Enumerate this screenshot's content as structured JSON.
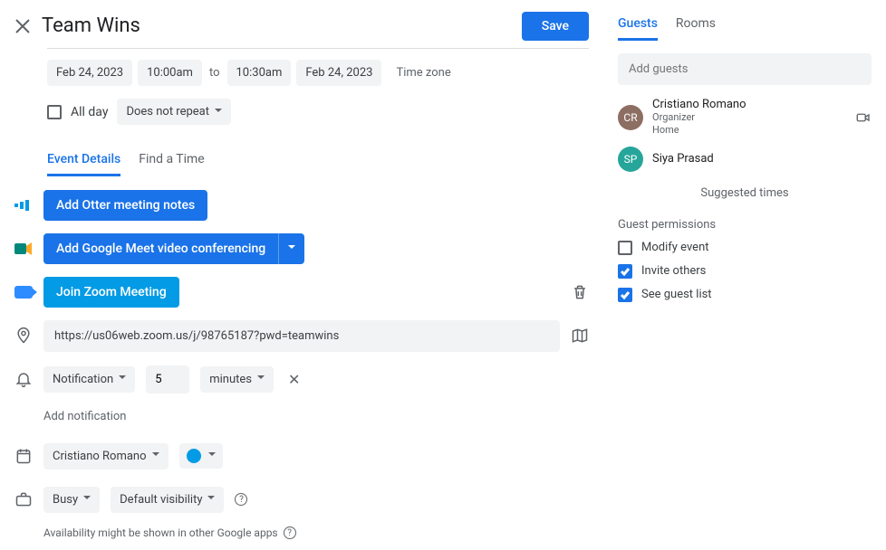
{
  "header": {
    "title": "Team Wins",
    "save_label": "Save"
  },
  "dates": {
    "start_date": "Feb 24, 2023",
    "start_time": "10:00am",
    "to_label": "to",
    "end_time": "10:30am",
    "end_date": "Feb 24, 2023",
    "timezone_label": "Time zone"
  },
  "allday": {
    "label": "All day",
    "checked": false,
    "repeat": "Does not repeat"
  },
  "tabs": {
    "details": "Event Details",
    "find_time": "Find a Time"
  },
  "buttons": {
    "otter": "Add Otter meeting notes",
    "meet": "Add Google Meet video conferencing",
    "zoom": "Join Zoom Meeting"
  },
  "location": {
    "value": "https://us06web.zoom.us/j/98765187?pwd=teamwins"
  },
  "notification": {
    "type": "Notification",
    "value": "5",
    "unit": "minutes",
    "add_label": "Add notification"
  },
  "calendar": {
    "owner": "Cristiano Romano"
  },
  "visibility": {
    "busy": "Busy",
    "default": "Default visibility",
    "availability_note": "Availability might be shown in other Google apps"
  },
  "sidebar": {
    "tabs": {
      "guests": "Guests",
      "rooms": "Rooms"
    },
    "add_placeholder": "Add guests",
    "guests": [
      {
        "name": "Cristiano Romano",
        "role": "Organizer",
        "status": "Home",
        "has_camera": true
      },
      {
        "name": "Siya Prasad",
        "role": "",
        "status": "",
        "has_camera": false
      }
    ],
    "suggested": "Suggested times",
    "permissions": {
      "title": "Guest permissions",
      "modify": {
        "label": "Modify event",
        "checked": false
      },
      "invite": {
        "label": "Invite others",
        "checked": true
      },
      "see": {
        "label": "See guest list",
        "checked": true
      }
    }
  }
}
